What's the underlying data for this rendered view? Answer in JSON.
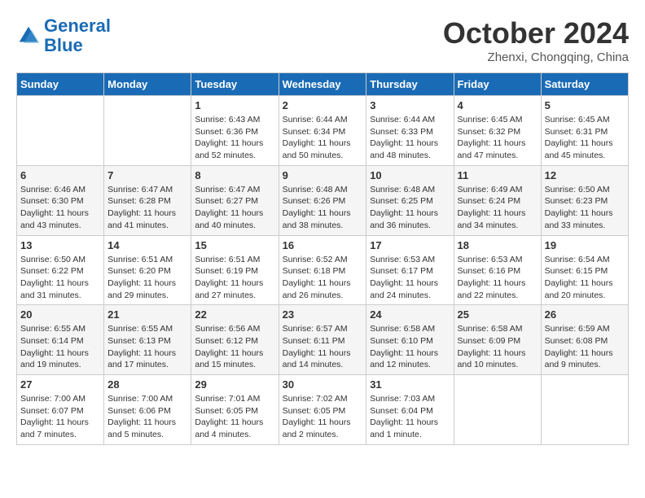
{
  "logo": {
    "line1": "General",
    "line2": "Blue"
  },
  "title": "October 2024",
  "subtitle": "Zhenxi, Chongqing, China",
  "days_header": [
    "Sunday",
    "Monday",
    "Tuesday",
    "Wednesday",
    "Thursday",
    "Friday",
    "Saturday"
  ],
  "weeks": [
    [
      {
        "day": "",
        "info": ""
      },
      {
        "day": "",
        "info": ""
      },
      {
        "day": "1",
        "info": "Sunrise: 6:43 AM\nSunset: 6:36 PM\nDaylight: 11 hours and 52 minutes."
      },
      {
        "day": "2",
        "info": "Sunrise: 6:44 AM\nSunset: 6:34 PM\nDaylight: 11 hours and 50 minutes."
      },
      {
        "day": "3",
        "info": "Sunrise: 6:44 AM\nSunset: 6:33 PM\nDaylight: 11 hours and 48 minutes."
      },
      {
        "day": "4",
        "info": "Sunrise: 6:45 AM\nSunset: 6:32 PM\nDaylight: 11 hours and 47 minutes."
      },
      {
        "day": "5",
        "info": "Sunrise: 6:45 AM\nSunset: 6:31 PM\nDaylight: 11 hours and 45 minutes."
      }
    ],
    [
      {
        "day": "6",
        "info": "Sunrise: 6:46 AM\nSunset: 6:30 PM\nDaylight: 11 hours and 43 minutes."
      },
      {
        "day": "7",
        "info": "Sunrise: 6:47 AM\nSunset: 6:28 PM\nDaylight: 11 hours and 41 minutes."
      },
      {
        "day": "8",
        "info": "Sunrise: 6:47 AM\nSunset: 6:27 PM\nDaylight: 11 hours and 40 minutes."
      },
      {
        "day": "9",
        "info": "Sunrise: 6:48 AM\nSunset: 6:26 PM\nDaylight: 11 hours and 38 minutes."
      },
      {
        "day": "10",
        "info": "Sunrise: 6:48 AM\nSunset: 6:25 PM\nDaylight: 11 hours and 36 minutes."
      },
      {
        "day": "11",
        "info": "Sunrise: 6:49 AM\nSunset: 6:24 PM\nDaylight: 11 hours and 34 minutes."
      },
      {
        "day": "12",
        "info": "Sunrise: 6:50 AM\nSunset: 6:23 PM\nDaylight: 11 hours and 33 minutes."
      }
    ],
    [
      {
        "day": "13",
        "info": "Sunrise: 6:50 AM\nSunset: 6:22 PM\nDaylight: 11 hours and 31 minutes."
      },
      {
        "day": "14",
        "info": "Sunrise: 6:51 AM\nSunset: 6:20 PM\nDaylight: 11 hours and 29 minutes."
      },
      {
        "day": "15",
        "info": "Sunrise: 6:51 AM\nSunset: 6:19 PM\nDaylight: 11 hours and 27 minutes."
      },
      {
        "day": "16",
        "info": "Sunrise: 6:52 AM\nSunset: 6:18 PM\nDaylight: 11 hours and 26 minutes."
      },
      {
        "day": "17",
        "info": "Sunrise: 6:53 AM\nSunset: 6:17 PM\nDaylight: 11 hours and 24 minutes."
      },
      {
        "day": "18",
        "info": "Sunrise: 6:53 AM\nSunset: 6:16 PM\nDaylight: 11 hours and 22 minutes."
      },
      {
        "day": "19",
        "info": "Sunrise: 6:54 AM\nSunset: 6:15 PM\nDaylight: 11 hours and 20 minutes."
      }
    ],
    [
      {
        "day": "20",
        "info": "Sunrise: 6:55 AM\nSunset: 6:14 PM\nDaylight: 11 hours and 19 minutes."
      },
      {
        "day": "21",
        "info": "Sunrise: 6:55 AM\nSunset: 6:13 PM\nDaylight: 11 hours and 17 minutes."
      },
      {
        "day": "22",
        "info": "Sunrise: 6:56 AM\nSunset: 6:12 PM\nDaylight: 11 hours and 15 minutes."
      },
      {
        "day": "23",
        "info": "Sunrise: 6:57 AM\nSunset: 6:11 PM\nDaylight: 11 hours and 14 minutes."
      },
      {
        "day": "24",
        "info": "Sunrise: 6:58 AM\nSunset: 6:10 PM\nDaylight: 11 hours and 12 minutes."
      },
      {
        "day": "25",
        "info": "Sunrise: 6:58 AM\nSunset: 6:09 PM\nDaylight: 11 hours and 10 minutes."
      },
      {
        "day": "26",
        "info": "Sunrise: 6:59 AM\nSunset: 6:08 PM\nDaylight: 11 hours and 9 minutes."
      }
    ],
    [
      {
        "day": "27",
        "info": "Sunrise: 7:00 AM\nSunset: 6:07 PM\nDaylight: 11 hours and 7 minutes."
      },
      {
        "day": "28",
        "info": "Sunrise: 7:00 AM\nSunset: 6:06 PM\nDaylight: 11 hours and 5 minutes."
      },
      {
        "day": "29",
        "info": "Sunrise: 7:01 AM\nSunset: 6:05 PM\nDaylight: 11 hours and 4 minutes."
      },
      {
        "day": "30",
        "info": "Sunrise: 7:02 AM\nSunset: 6:05 PM\nDaylight: 11 hours and 2 minutes."
      },
      {
        "day": "31",
        "info": "Sunrise: 7:03 AM\nSunset: 6:04 PM\nDaylight: 11 hours and 1 minute."
      },
      {
        "day": "",
        "info": ""
      },
      {
        "day": "",
        "info": ""
      }
    ]
  ]
}
